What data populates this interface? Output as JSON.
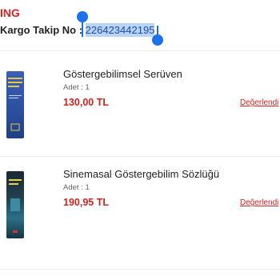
{
  "order": {
    "status": "ING",
    "cargo_label": "Kargo Takip No : ",
    "cargo_number": "226423442195"
  },
  "items": [
    {
      "title": "Göstergebilimsel Serüven",
      "qty": "Adet : 1",
      "price": "130,00 TL",
      "review": "Değerlendi"
    },
    {
      "title": "Sinemasal Göstergebilim Sözlüğü",
      "qty": "Adet : 1",
      "price": "190,95 TL",
      "review": "Değerlendi"
    }
  ],
  "colors": {
    "accent": "#d0231f",
    "selection_handle": "#1a73e8",
    "selection_bg": "#b9d4f7"
  }
}
